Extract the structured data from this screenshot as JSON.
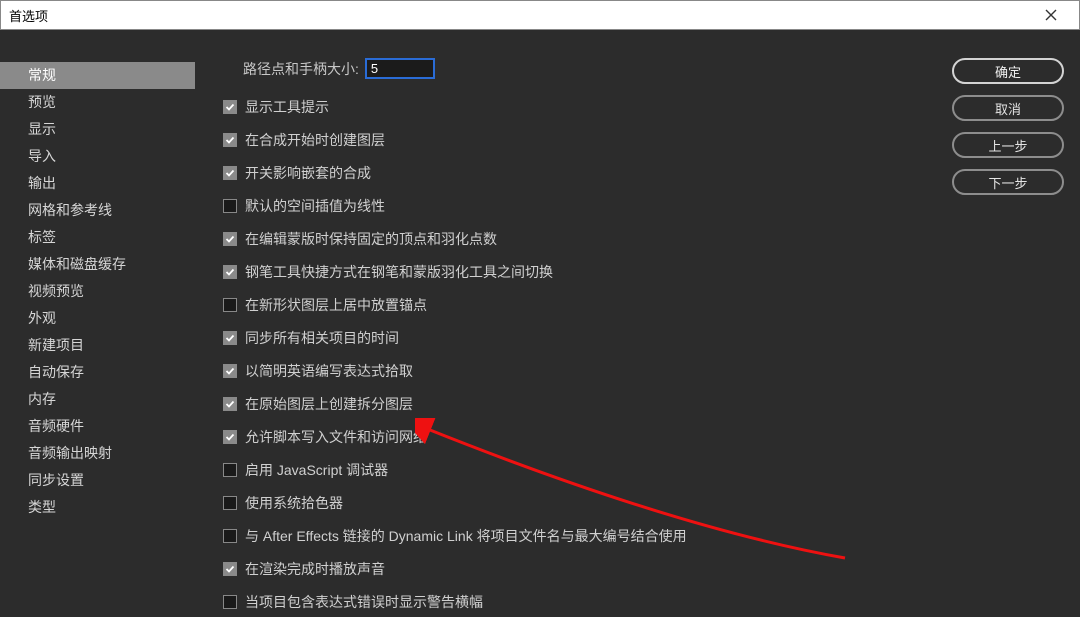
{
  "window": {
    "title": "首选项"
  },
  "sidebar": {
    "items": [
      {
        "label": "常规",
        "selected": true
      },
      {
        "label": "预览",
        "selected": false
      },
      {
        "label": "显示",
        "selected": false
      },
      {
        "label": "导入",
        "selected": false
      },
      {
        "label": "输出",
        "selected": false
      },
      {
        "label": "网格和参考线",
        "selected": false
      },
      {
        "label": "标签",
        "selected": false
      },
      {
        "label": "媒体和磁盘缓存",
        "selected": false
      },
      {
        "label": "视频预览",
        "selected": false
      },
      {
        "label": "外观",
        "selected": false
      },
      {
        "label": "新建项目",
        "selected": false
      },
      {
        "label": "自动保存",
        "selected": false
      },
      {
        "label": "内存",
        "selected": false
      },
      {
        "label": "音频硬件",
        "selected": false
      },
      {
        "label": "音频输出映射",
        "selected": false
      },
      {
        "label": "同步设置",
        "selected": false
      },
      {
        "label": "类型",
        "selected": false
      }
    ]
  },
  "main": {
    "path_label": "路径点和手柄大小:",
    "path_value": "5",
    "checkboxes": [
      {
        "label": "显示工具提示",
        "checked": true
      },
      {
        "label": "在合成开始时创建图层",
        "checked": true
      },
      {
        "label": "开关影响嵌套的合成",
        "checked": true
      },
      {
        "label": "默认的空间插值为线性",
        "checked": false
      },
      {
        "label": "在编辑蒙版时保持固定的顶点和羽化点数",
        "checked": true
      },
      {
        "label": "钢笔工具快捷方式在钢笔和蒙版羽化工具之间切换",
        "checked": true
      },
      {
        "label": "在新形状图层上居中放置锚点",
        "checked": false
      },
      {
        "label": "同步所有相关项目的时间",
        "checked": true
      },
      {
        "label": "以简明英语编写表达式拾取",
        "checked": true
      },
      {
        "label": "在原始图层上创建拆分图层",
        "checked": true
      },
      {
        "label": "允许脚本写入文件和访问网络",
        "checked": true
      },
      {
        "label": "启用 JavaScript 调试器",
        "checked": false
      },
      {
        "label": "使用系统拾色器",
        "checked": false
      },
      {
        "label": "与 After Effects 链接的 Dynamic Link 将项目文件名与最大编号结合使用",
        "checked": false
      },
      {
        "label": "在渲染完成时播放声音",
        "checked": true
      },
      {
        "label": "当项目包含表达式错误时显示警告横幅",
        "checked": false
      }
    ]
  },
  "buttons": {
    "ok": "确定",
    "cancel": "取消",
    "prev": "上一步",
    "next": "下一步"
  }
}
